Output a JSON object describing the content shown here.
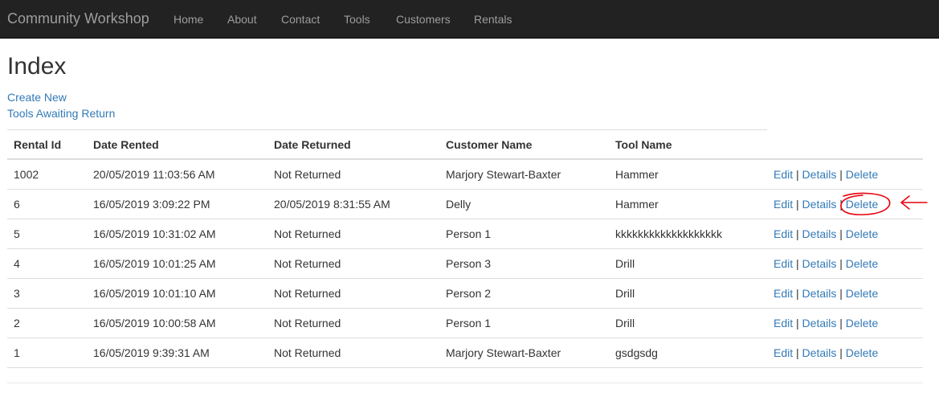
{
  "navbar": {
    "brand": "Community Workshop",
    "items": [
      {
        "label": "Home"
      },
      {
        "label": "About"
      },
      {
        "label": "Contact"
      },
      {
        "label": "Tools"
      },
      {
        "label": "Customers"
      },
      {
        "label": "Rentals"
      }
    ]
  },
  "page": {
    "title": "Index",
    "create_new": "Create New",
    "tools_awaiting_return": "Tools Awaiting Return"
  },
  "table": {
    "headers": [
      "Rental Id",
      "Date Rented",
      "Date Returned",
      "Customer Name",
      "Tool Name"
    ],
    "rows": [
      {
        "id": "1002",
        "rented": "20/05/2019 11:03:56 AM",
        "returned": "Not Returned",
        "customer": "Marjory Stewart-Baxter",
        "tool": "Hammer"
      },
      {
        "id": "6",
        "rented": "16/05/2019 3:09:22 PM",
        "returned": "20/05/2019 8:31:55 AM",
        "customer": "Delly",
        "tool": "Hammer"
      },
      {
        "id": "5",
        "rented": "16/05/2019 10:31:02 AM",
        "returned": "Not Returned",
        "customer": "Person 1",
        "tool": "kkkkkkkkkkkkkkkkkkk"
      },
      {
        "id": "4",
        "rented": "16/05/2019 10:01:25 AM",
        "returned": "Not Returned",
        "customer": "Person 3",
        "tool": "Drill"
      },
      {
        "id": "3",
        "rented": "16/05/2019 10:01:10 AM",
        "returned": "Not Returned",
        "customer": "Person 2",
        "tool": "Drill"
      },
      {
        "id": "2",
        "rented": "16/05/2019 10:00:58 AM",
        "returned": "Not Returned",
        "customer": "Person 1",
        "tool": "Drill"
      },
      {
        "id": "1",
        "rented": "16/05/2019 9:39:31 AM",
        "returned": "Not Returned",
        "customer": "Marjory Stewart-Baxter",
        "tool": "gsdgsdg"
      }
    ],
    "actions": {
      "edit": "Edit",
      "details": "Details",
      "delete": "Delete",
      "separator": "|"
    }
  },
  "colors": {
    "navbar_bg": "#222222",
    "nav_text": "#9d9d9d",
    "link": "#337ab7",
    "annotation": "#e8000b"
  },
  "annotation": {
    "type": "red-circle-and-arrow",
    "target": "Delete link, row 2"
  }
}
